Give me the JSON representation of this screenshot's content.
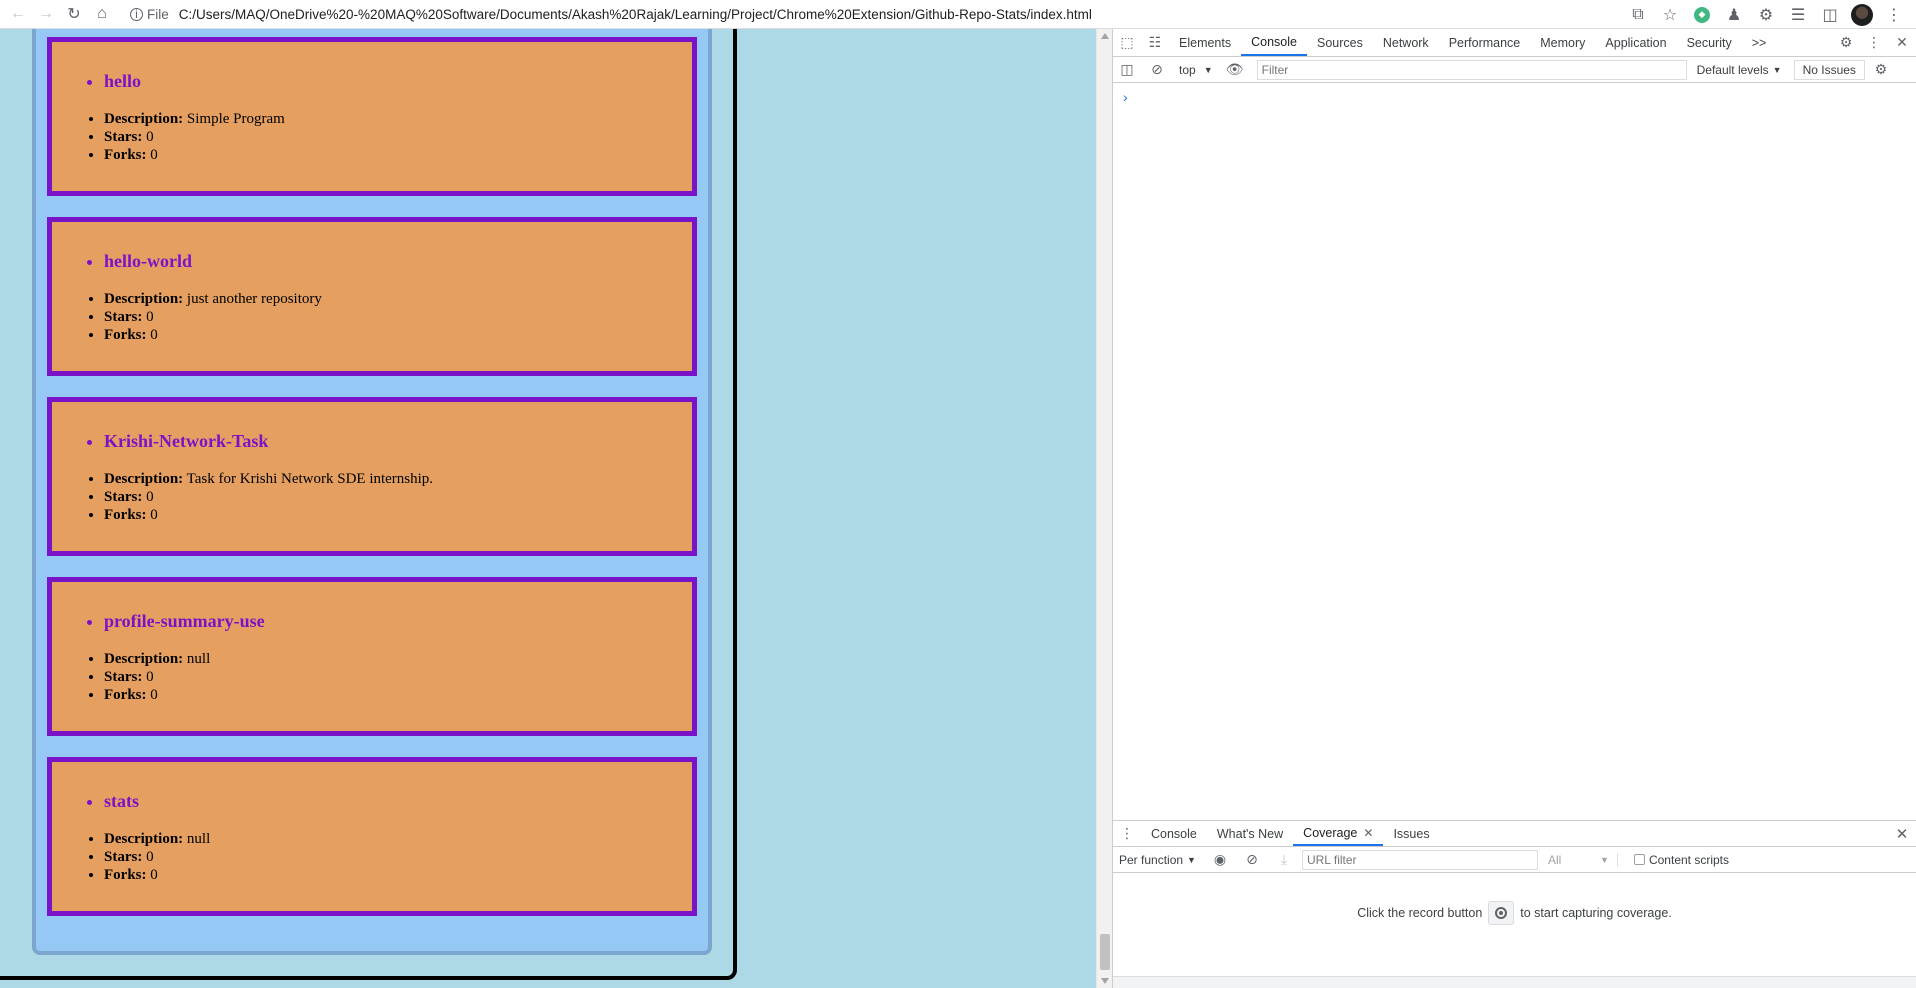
{
  "browser": {
    "scheme_label": "File",
    "url": "C:/Users/MAQ/OneDrive%20-%20MAQ%20Software/Documents/Akash%20Rajak/Learning/Project/Chrome%20Extension/Github-Repo-Stats/index.html"
  },
  "repos": [
    {
      "name": "hello",
      "description_label": "Description:",
      "description": "Simple Program",
      "stars_label": "Stars:",
      "stars": "0",
      "forks_label": "Forks:",
      "forks": "0"
    },
    {
      "name": "hello-world",
      "description_label": "Description:",
      "description": "just another repository",
      "stars_label": "Stars:",
      "stars": "0",
      "forks_label": "Forks:",
      "forks": "0"
    },
    {
      "name": "Krishi-Network-Task",
      "description_label": "Description:",
      "description": "Task for Krishi Network SDE internship.",
      "stars_label": "Stars:",
      "stars": "0",
      "forks_label": "Forks:",
      "forks": "0"
    },
    {
      "name": "profile-summary-use",
      "description_label": "Description:",
      "description": "null",
      "stars_label": "Stars:",
      "stars": "0",
      "forks_label": "Forks:",
      "forks": "0"
    },
    {
      "name": "stats",
      "description_label": "Description:",
      "description": "null",
      "stars_label": "Stars:",
      "stars": "0",
      "forks_label": "Forks:",
      "forks": "0"
    }
  ],
  "devtools": {
    "tabs": [
      "Elements",
      "Console",
      "Sources",
      "Network",
      "Performance",
      "Memory",
      "Application",
      "Security"
    ],
    "overflow": ">>",
    "context": "top",
    "filter_placeholder": "Filter",
    "levels": "Default levels",
    "issues": "No Issues",
    "prompt": "›",
    "drawer": {
      "tabs": [
        "Console",
        "What's New",
        "Coverage",
        "Issues"
      ],
      "per_function": "Per function",
      "url_filter_placeholder": "URL filter",
      "all_option": "All",
      "content_scripts": "Content scripts",
      "msg_before": "Click the record button",
      "msg_after": "to start capturing coverage."
    }
  },
  "colors": {
    "page_bg": "#add8e6",
    "card_bg": "#e5a061",
    "card_border": "#7a13c7",
    "container_bg": "#96c8f6",
    "accent": "#1a73e8"
  }
}
